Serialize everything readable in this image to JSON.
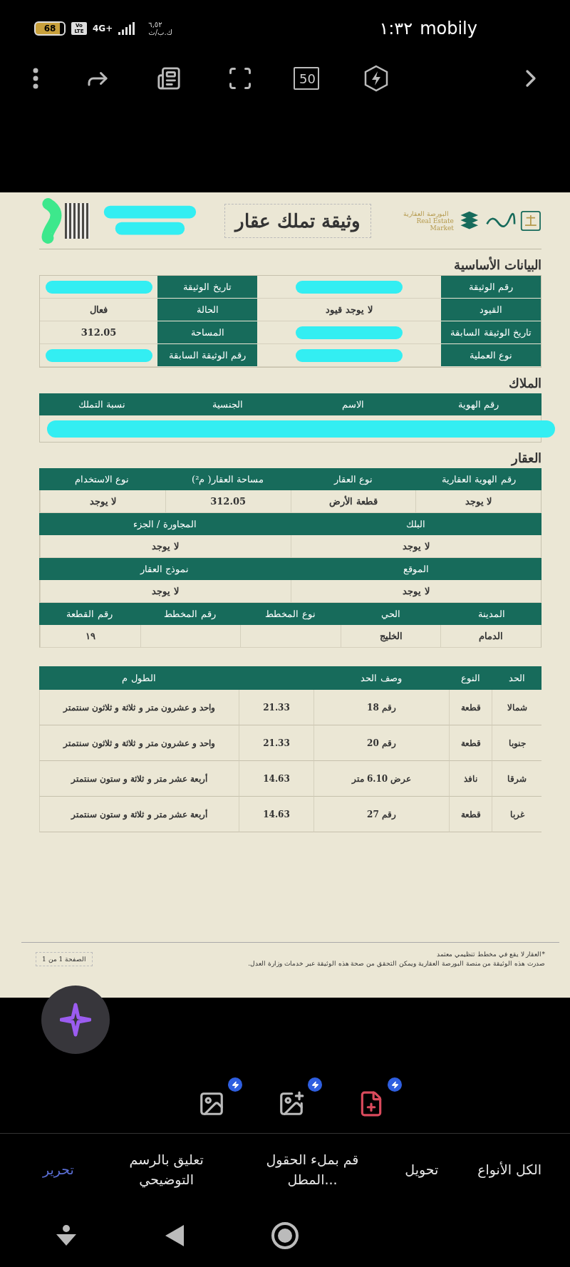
{
  "status_bar": {
    "carrier": "mobily",
    "time": "١:٣٢",
    "speed": "٦,٥٢",
    "speed_unit": "ك.ب/ث",
    "network": "4G+",
    "volte": "Vo LTE",
    "battery": "68"
  },
  "toolbar": {
    "zoom_badge": "50"
  },
  "document": {
    "title": "وثيقة تملك عقار",
    "market_logo_arabic": "البورصة العقارية",
    "market_logo_text": "Real Estate Market",
    "basic": {
      "title": "البيانات الأساسية",
      "fields": [
        {
          "label": "رقم الوثيقة",
          "redacted": true
        },
        {
          "label": "تاريخ الوثيقة",
          "redacted": true
        },
        {
          "label": "القيود",
          "value": "لا يوجد قيود",
          "redacted": false
        },
        {
          "label": "الحالة",
          "value": "فعال",
          "redacted": false
        },
        {
          "label": "تاريخ الوثيقة السابقة",
          "redacted": true
        },
        {
          "label": "المساحة",
          "value": "312.05",
          "redacted": false
        },
        {
          "label": "نوع العملية",
          "redacted": true
        },
        {
          "label": "رقم الوثيقة السابقة",
          "redacted": true
        }
      ]
    },
    "owners": {
      "title": "الملاك",
      "columns": [
        "رقم الهوية",
        "الاسم",
        "الجنسية",
        "نسبة التملك"
      ],
      "rows_redacted": true
    },
    "property": {
      "title": "العقار",
      "groups": [
        [
          {
            "label": "رقم الهوية العقارية",
            "value": "لا يوجد"
          },
          {
            "label": "نوع العقار",
            "value": "قطعة الأرض"
          },
          {
            "label": "مساحة العقار( م²)",
            "value": "312.05"
          },
          {
            "label": "نوع الاستخدام",
            "value": "لا يوجد"
          }
        ],
        [
          {
            "label": "البلك",
            "value": "لا يوجد"
          },
          {
            "label": "المجاورة / الجزء",
            "value": "لا يوجد"
          }
        ],
        [
          {
            "label": "الموقع",
            "value": "لا يوجد"
          },
          {
            "label": "نموذج العقار",
            "value": "لا يوجد"
          }
        ],
        [
          {
            "label": "المدينة",
            "value": "الدمام"
          },
          {
            "label": "الحي",
            "value": "الخليج"
          },
          {
            "label": "نوع المخطط"
          },
          {
            "label": "رقم المخطط"
          },
          {
            "label": "رقم القطعة",
            "value": "١٩"
          }
        ]
      ]
    },
    "boundaries": {
      "columns": [
        "الحد",
        "النوع",
        "وصف الحد",
        "الطول م"
      ],
      "rows": [
        {
          "side": "شمالا",
          "type": "قطعة",
          "description": "رقم 18",
          "length": "21.33",
          "length_words": "واحد و عشرون متر و ثلاثة و ثلاثون سنتمتر"
        },
        {
          "side": "جنوبا",
          "type": "قطعة",
          "description": "رقم 20",
          "length": "21.33",
          "length_words": "واحد و عشرون متر و ثلاثة و ثلاثون سنتمتر"
        },
        {
          "side": "شرقا",
          "type": "نافذ",
          "description": "عرض 6.10 متر",
          "length": "14.63",
          "length_words": "أربعة عشر متر و ثلاثة و ستون سنتمتر"
        },
        {
          "side": "غربا",
          "type": "قطعة",
          "description": "رقم 27",
          "length": "14.63",
          "length_words": "أربعة عشر متر و ثلاثة و ستون سنتمتر"
        }
      ]
    },
    "footer": {
      "notes": [
        "*العقار لا يقع في مخطط تنظيمي معتمد",
        "صدرت هذه الوثيقة من منصة البورصة العقارية ويمكن التحقق من صحة هذه الوثيقة عبر خدمات وزارة العدل."
      ],
      "page": "الصفحة 1 من 1"
    }
  },
  "tabs": [
    {
      "label": "الكل الأنواع",
      "selected": false
    },
    {
      "label": "تحويل",
      "selected": false
    },
    {
      "label": "قم بملء الحقول المطل...",
      "selected": false
    },
    {
      "label": "تعليق بالرسم التوضيحي",
      "selected": false
    },
    {
      "label": "تحرير",
      "selected": true
    }
  ]
}
